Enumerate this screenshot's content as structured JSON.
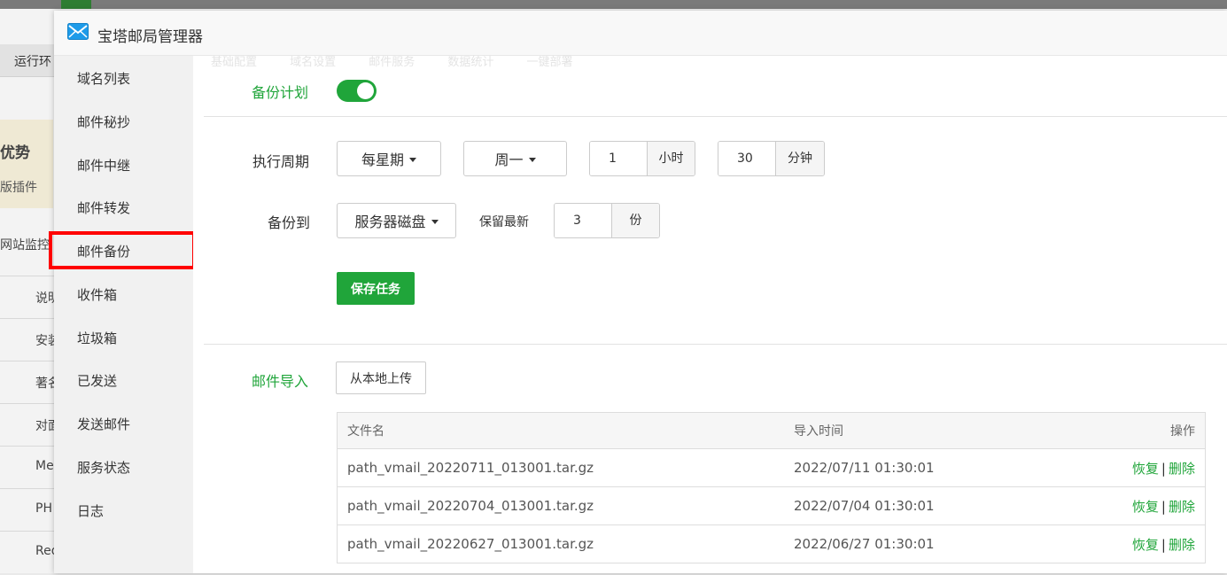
{
  "background": {
    "nav_label": "运行环",
    "adv_title": "优势",
    "adv_sub": "版插件",
    "monitor": "网站监控",
    "rows": [
      "说明",
      "安装",
      "著名",
      "对面",
      "Me",
      "PH",
      "Red"
    ]
  },
  "modal": {
    "title": "宝塔邮局管理器",
    "ghost_tabs": [
      "基础配置",
      "域名设置",
      "邮件服务",
      "数据统计",
      "一键部署"
    ]
  },
  "sidebar": {
    "items": [
      {
        "label": "域名列表"
      },
      {
        "label": "邮件秘抄"
      },
      {
        "label": "邮件中继"
      },
      {
        "label": "邮件转发"
      },
      {
        "label": "邮件备份"
      },
      {
        "label": "收件箱"
      },
      {
        "label": "垃圾箱"
      },
      {
        "label": "已发送"
      },
      {
        "label": "发送邮件"
      },
      {
        "label": "服务状态"
      },
      {
        "label": "日志"
      }
    ]
  },
  "backup": {
    "plan_label": "备份计划",
    "plan_enabled": true,
    "cycle_label": "执行周期",
    "cycle_type": "每星期",
    "weekday": "周一",
    "hour_value": "1",
    "hour_unit": "小时",
    "minute_value": "30",
    "minute_unit": "分钟",
    "target_label": "备份到",
    "target_value": "服务器磁盘",
    "keep_label": "保留最新",
    "keep_value": "3",
    "keep_unit": "份",
    "save_button": "保存任务"
  },
  "import": {
    "label": "邮件导入",
    "upload_button": "从本地上传",
    "columns": [
      "文件名",
      "导入时间",
      "操作"
    ],
    "restore_label": "恢复",
    "delete_label": "删除",
    "rows": [
      {
        "file": "path_vmail_20220711_013001.tar.gz",
        "time": "2022/07/11 01:30:01"
      },
      {
        "file": "path_vmail_20220704_013001.tar.gz",
        "time": "2022/07/04 01:30:01"
      },
      {
        "file": "path_vmail_20220627_013001.tar.gz",
        "time": "2022/06/27 01:30:01"
      }
    ]
  },
  "colors": {
    "accent": "#20a53a",
    "highlight": "#ff0000"
  }
}
